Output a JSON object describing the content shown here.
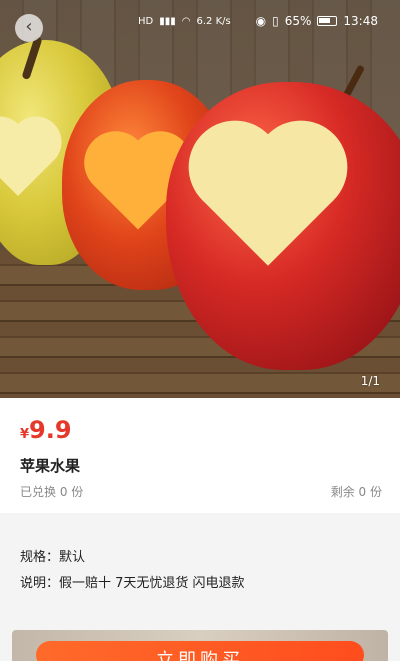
{
  "status_bar": {
    "network_label": "HD",
    "speed": "6.2",
    "speed_unit": "K/s",
    "battery": "65%",
    "time": "13:48"
  },
  "gallery": {
    "counter": "1/1"
  },
  "product": {
    "currency": "¥",
    "price": "9.9",
    "name": "苹果水果",
    "exchanged": "已兑换 0 份",
    "remaining": "剩余 0 份"
  },
  "details": {
    "spec": "规格：默认",
    "description": "说明：假一赔十 7天无忧退货 闪电退款"
  },
  "actions": {
    "buy_label": "立即购买"
  },
  "icons": [
    "back-icon",
    "wifi-icon",
    "signal-icon",
    "eye-icon",
    "vibrate-icon",
    "battery-icon"
  ]
}
